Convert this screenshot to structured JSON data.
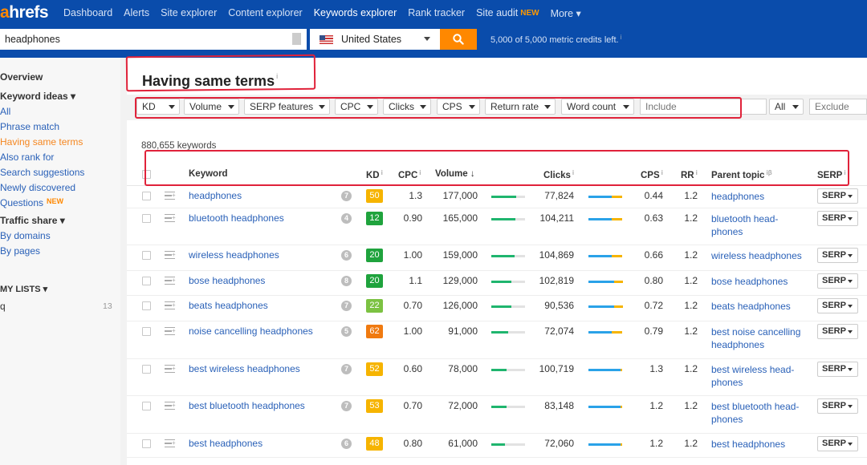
{
  "nav": {
    "logo_a": "a",
    "logo_rest": "hrefs",
    "items": [
      {
        "label": "Dashboard"
      },
      {
        "label": "Alerts"
      },
      {
        "label": "Site explorer"
      },
      {
        "label": "Content explorer"
      },
      {
        "label": "Keywords explorer",
        "active": true
      },
      {
        "label": "Rank tracker"
      },
      {
        "label": "Site audit",
        "badge": "NEW"
      },
      {
        "label": "More ▾"
      }
    ]
  },
  "search": {
    "query": "headphones",
    "country": "United States",
    "credits": "5,000 of 5,000 metric credits left.",
    "credits_info": "i"
  },
  "sidebar": {
    "overview": "Overview",
    "keyword_ideas": "Keyword ideas ▾",
    "items": [
      {
        "label": "All"
      },
      {
        "label": "Phrase match"
      },
      {
        "label": "Having same terms",
        "selected": true
      },
      {
        "label": "Also rank for"
      },
      {
        "label": "Search suggestions"
      },
      {
        "label": "Newly discovered"
      },
      {
        "label": "Questions",
        "badge": "NEW"
      }
    ],
    "traffic_share": "Traffic share ▾",
    "traffic_items": [
      {
        "label": "By domains"
      },
      {
        "label": "By pages"
      }
    ],
    "my_lists": "MY LISTS ▾",
    "lists": [
      {
        "name": "q",
        "count": "13"
      }
    ]
  },
  "main": {
    "title": "Having same terms",
    "title_info": "i",
    "filters": [
      "KD",
      "Volume",
      "SERP features",
      "CPC",
      "Clicks",
      "CPS",
      "Return rate",
      "Word count"
    ],
    "include_placeholder": "Include",
    "all_label": "All",
    "exclude_placeholder": "Exclude",
    "keyword_count": "880,655 keywords"
  },
  "table": {
    "headers": {
      "keyword": "Keyword",
      "kd": "KD",
      "cpc": "CPC",
      "volume": "Volume",
      "volume_sort": "↓",
      "clicks": "Clicks",
      "cps": "CPS",
      "rr": "RR",
      "parent_topic": "Parent topic",
      "parent_topic_info": "iβ",
      "serp": "SERP",
      "info": "i"
    },
    "rows": [
      {
        "keyword": "headphones",
        "words": "7",
        "kd": "50",
        "kd_color": "#f6b400",
        "cpc": "1.3",
        "volume": "177,000",
        "vol_fill": 1.0,
        "clicks": "77,824",
        "clicks_paid": 0.3,
        "cps": "0.44",
        "rr": "1.2",
        "parent": "headphones",
        "serp": "SERP"
      },
      {
        "keyword": "bluetooth headphones",
        "words": "4",
        "kd": "12",
        "kd_color": "#1fa33d",
        "cpc": "0.90",
        "volume": "165,000",
        "vol_fill": 0.93,
        "clicks": "104,211",
        "clicks_paid": 0.3,
        "cps": "0.63",
        "rr": "1.2",
        "parent": "bluetooth head-phones",
        "serp": "SERP"
      },
      {
        "keyword": "wireless headphones",
        "words": "6",
        "kd": "20",
        "kd_color": "#1fa33d",
        "cpc": "1.00",
        "volume": "159,000",
        "vol_fill": 0.9,
        "clicks": "104,869",
        "clicks_paid": 0.3,
        "cps": "0.66",
        "rr": "1.2",
        "parent": "wireless headphones",
        "serp": "SERP"
      },
      {
        "keyword": "bose headphones",
        "words": "8",
        "kd": "20",
        "kd_color": "#1fa33d",
        "cpc": "1.1",
        "volume": "129,000",
        "vol_fill": 0.73,
        "clicks": "102,819",
        "clicks_paid": 0.25,
        "cps": "0.80",
        "rr": "1.2",
        "parent": "bose headphones",
        "serp": "SERP"
      },
      {
        "keyword": "beats headphones",
        "words": "7",
        "kd": "22",
        "kd_color": "#7cc242",
        "cpc": "0.70",
        "volume": "126,000",
        "vol_fill": 0.71,
        "clicks": "90,536",
        "clicks_paid": 0.25,
        "cps": "0.72",
        "rr": "1.2",
        "parent": "beats headphones",
        "serp": "SERP"
      },
      {
        "keyword": "noise cancelling headphones",
        "words": "5",
        "kd": "62",
        "kd_color": "#f07a10",
        "cpc": "1.00",
        "volume": "91,000",
        "vol_fill": 0.51,
        "clicks": "72,074",
        "clicks_paid": 0.3,
        "cps": "0.79",
        "rr": "1.2",
        "parent": "best noise cancelling headphones",
        "serp": "SERP"
      },
      {
        "keyword": "best wireless headphones",
        "words": "7",
        "kd": "52",
        "kd_color": "#f6b400",
        "cpc": "0.60",
        "volume": "78,000",
        "vol_fill": 0.44,
        "clicks": "100,719",
        "clicks_paid": 0.05,
        "cps": "1.3",
        "rr": "1.2",
        "parent": "best wireless head-phones",
        "serp": "SERP"
      },
      {
        "keyword": "best bluetooth headphones",
        "words": "7",
        "kd": "53",
        "kd_color": "#f6b400",
        "cpc": "0.70",
        "volume": "72,000",
        "vol_fill": 0.41,
        "clicks": "83,148",
        "clicks_paid": 0.05,
        "cps": "1.2",
        "rr": "1.2",
        "parent": "best bluetooth head-phones",
        "serp": "SERP"
      },
      {
        "keyword": "best headphones",
        "words": "6",
        "kd": "48",
        "kd_color": "#f6b400",
        "cpc": "0.80",
        "volume": "61,000",
        "vol_fill": 0.34,
        "clicks": "72,060",
        "clicks_paid": 0.05,
        "cps": "1.2",
        "rr": "1.2",
        "parent": "best headphones",
        "serp": "SERP"
      }
    ]
  }
}
